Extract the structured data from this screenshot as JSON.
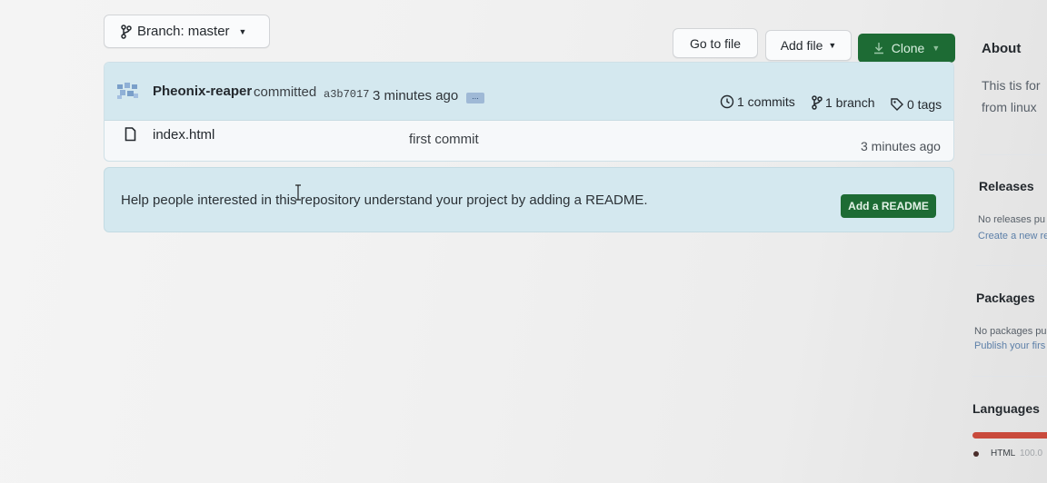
{
  "branch": {
    "prefix": "Branch:",
    "name": "master"
  },
  "toolbar": {
    "go_to_file": "Go to file",
    "add_file": "Add file",
    "clone": "Clone"
  },
  "commit_bar": {
    "author": "Pheonix-reaper",
    "verb": "committed",
    "sha": "a3b7017",
    "time": "3 minutes ago",
    "ellipsis": "...",
    "commits": "1 commits",
    "branches": "1 branch",
    "tags": "0 tags"
  },
  "files": [
    {
      "name": "index.html",
      "message": "first commit",
      "time": "3 minutes ago"
    }
  ],
  "readme_prompt": {
    "text": "Help people interested in this repository understand your project by adding a README.",
    "button": "Add a README"
  },
  "sidebar": {
    "about_title": "About",
    "about_line1": "This tis for",
    "about_line2": "from linux",
    "releases_title": "Releases",
    "releases_line1": "No releases pu",
    "releases_line2": "Create a new re",
    "packages_title": "Packages",
    "packages_line1": "No packages pu",
    "packages_line2": "Publish your firs",
    "languages_title": "Languages",
    "language_name": "HTML",
    "language_percent": "100.0",
    "language_color": "#c94a3c"
  },
  "colors": {
    "accent_green": "#1d6b34",
    "banner_blue": "#d4e8ef"
  }
}
